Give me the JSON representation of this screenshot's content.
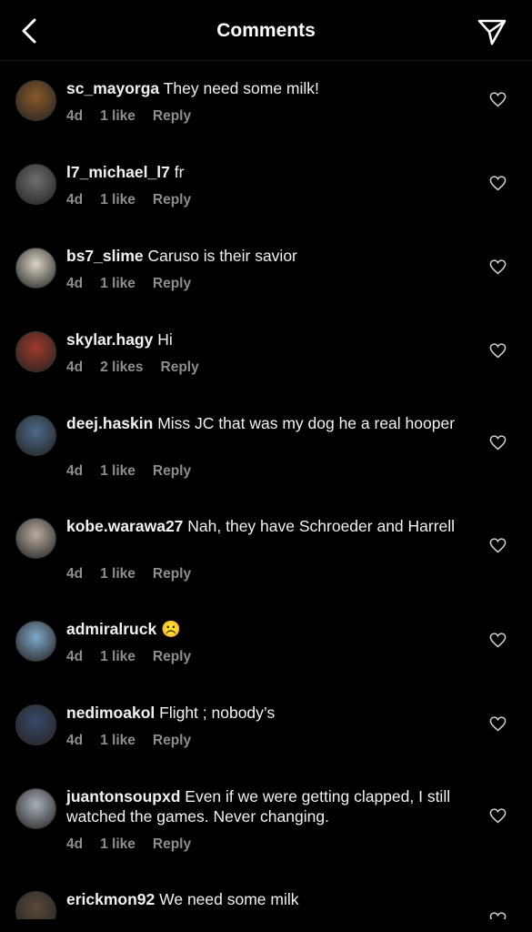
{
  "header": {
    "title": "Comments",
    "back_icon": "chevron-left-icon",
    "share_icon": "paper-plane-icon"
  },
  "comments": [
    {
      "username": "sc_mayorga",
      "text": "They need some milk!",
      "age": "4d",
      "likes": "1 like",
      "reply": "Reply",
      "avatar_color": "#8a5a2a"
    },
    {
      "username": "l7_michael_l7",
      "text": "fr",
      "age": "4d",
      "likes": "1 like",
      "reply": "Reply",
      "avatar_color": "#6f6f6f"
    },
    {
      "username": "bs7_slime",
      "text": "Caruso is their savior",
      "age": "4d",
      "likes": "1 like",
      "reply": "Reply",
      "avatar_color": "#d9d3c4"
    },
    {
      "username": "skylar.hagy",
      "text": "Hi",
      "age": "4d",
      "likes": "2 likes",
      "reply": "Reply",
      "avatar_color": "#a03a2a"
    },
    {
      "username": "deej.haskin",
      "text": "Miss JC that was my dog he a real hooper",
      "age": "4d",
      "likes": "1 like",
      "reply": "Reply",
      "avatar_color": "#4d6a8a"
    },
    {
      "username": "kobe.warawa27",
      "text": "Nah, they have Schroeder and Harrell",
      "age": "4d",
      "likes": "1 like",
      "reply": "Reply",
      "avatar_color": "#b9aca0"
    },
    {
      "username": "admiralruck",
      "text": "☹️",
      "age": "4d",
      "likes": "1 like",
      "reply": "Reply",
      "avatar_color": "#7fa8c8"
    },
    {
      "username": "nedimoakol",
      "text": "Flight ; nobody’s",
      "age": "4d",
      "likes": "1 like",
      "reply": "Reply",
      "avatar_color": "#3a4a6a"
    },
    {
      "username": "juantonsoupxd",
      "text": "Even if we were getting clapped, I still watched the games. Never changing.",
      "age": "4d",
      "likes": "1 like",
      "reply": "Reply",
      "avatar_color": "#a9b0b8"
    },
    {
      "username": "erickmon92",
      "text": "We need some milk",
      "age": "",
      "likes": "",
      "reply": "",
      "avatar_color": "#5a4a3a"
    }
  ],
  "colors": {
    "background": "#000000",
    "meta": "#8e8e8e",
    "text": "#f2f2f2"
  }
}
